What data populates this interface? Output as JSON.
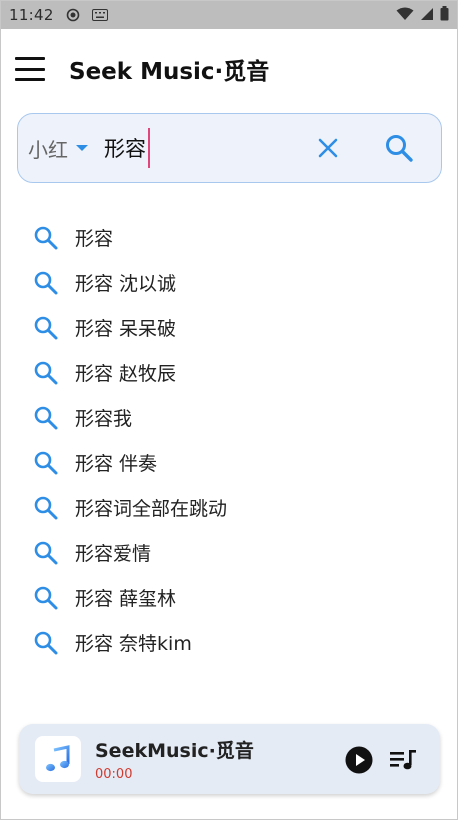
{
  "status_bar": {
    "time": "11:42"
  },
  "app_bar": {
    "title": "Seek Music·觅音"
  },
  "search": {
    "source_label": "小红",
    "query": "形容"
  },
  "suggestions": [
    "形容",
    "形容 沈以诚",
    "形容 呆呆破",
    "形容 赵牧辰",
    "形容我",
    "形容 伴奏",
    "形容词全部在跳动",
    "形容爱情",
    "形容 薛玺林",
    "形容 奈特kim"
  ],
  "player": {
    "title": "SeekMusic·觅音",
    "time": "00:00"
  },
  "colors": {
    "accent": "#2e8ee6",
    "search_bg": "#eef3fb",
    "player_bg": "#e5ebf5",
    "time_red": "#d03a2f",
    "cursor_pink": "#e0457b"
  },
  "icons": {
    "menu": "menu-icon",
    "clear": "close-icon",
    "search": "search-icon",
    "play": "play-icon",
    "queue": "playlist-icon",
    "cover": "music-note-icon"
  }
}
